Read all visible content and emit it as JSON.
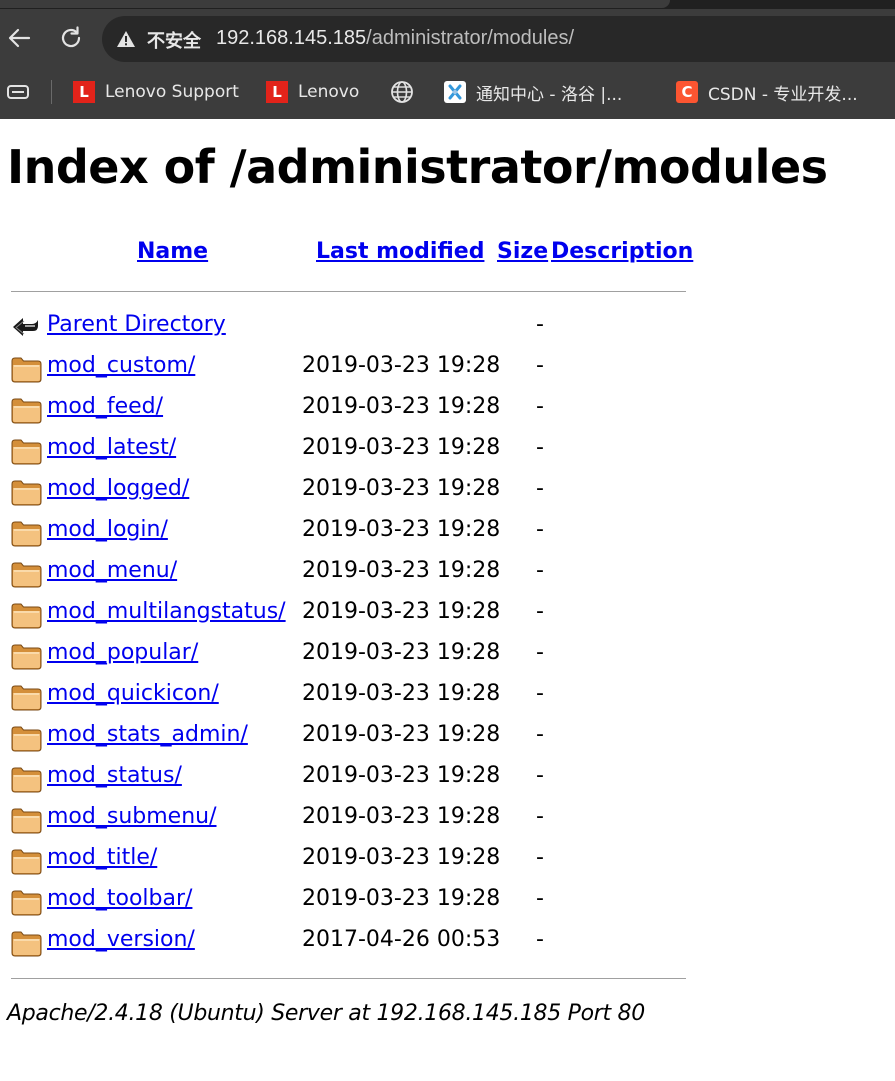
{
  "browser": {
    "security_label": "不安全",
    "url_host": "192.168.145.185",
    "url_path": "/administrator/modules/",
    "bookmarks": [
      {
        "label": "Lenovo Support",
        "icon": "lenovo-l-icon",
        "color": "#e2231a"
      },
      {
        "label": "Lenovo",
        "icon": "lenovo-l-icon",
        "color": "#e2231a"
      },
      {
        "label": "",
        "icon": "globe-icon",
        "color": "#e8e8e8"
      },
      {
        "label": "通知中心 - 洛谷 |...",
        "icon": "luogu-icon",
        "color": "#3498db"
      },
      {
        "label": "CSDN - 专业开发...",
        "icon": "csdn-c-icon",
        "color": "#fc5531"
      }
    ]
  },
  "page": {
    "title": "Index of /administrator/modules",
    "columns": {
      "name": "Name",
      "last_modified": "Last modified",
      "size": "Size",
      "description": "Description"
    },
    "parent": {
      "name": "Parent Directory",
      "size": "-",
      "icon": "back-arrow-icon"
    },
    "entries": [
      {
        "name": "mod_custom/",
        "modified": "2019-03-23 19:28",
        "size": "-"
      },
      {
        "name": "mod_feed/",
        "modified": "2019-03-23 19:28",
        "size": "-"
      },
      {
        "name": "mod_latest/",
        "modified": "2019-03-23 19:28",
        "size": "-"
      },
      {
        "name": "mod_logged/",
        "modified": "2019-03-23 19:28",
        "size": "-"
      },
      {
        "name": "mod_login/",
        "modified": "2019-03-23 19:28",
        "size": "-"
      },
      {
        "name": "mod_menu/",
        "modified": "2019-03-23 19:28",
        "size": "-"
      },
      {
        "name": "mod_multilangstatus/",
        "modified": "2019-03-23 19:28",
        "size": "-"
      },
      {
        "name": "mod_popular/",
        "modified": "2019-03-23 19:28",
        "size": "-"
      },
      {
        "name": "mod_quickicon/",
        "modified": "2019-03-23 19:28",
        "size": "-"
      },
      {
        "name": "mod_stats_admin/",
        "modified": "2019-03-23 19:28",
        "size": "-"
      },
      {
        "name": "mod_status/",
        "modified": "2019-03-23 19:28",
        "size": "-"
      },
      {
        "name": "mod_submenu/",
        "modified": "2019-03-23 19:28",
        "size": "-"
      },
      {
        "name": "mod_title/",
        "modified": "2019-03-23 19:28",
        "size": "-"
      },
      {
        "name": "mod_toolbar/",
        "modified": "2019-03-23 19:28",
        "size": "-"
      },
      {
        "name": "mod_version/",
        "modified": "2017-04-26 00:53",
        "size": "-"
      }
    ],
    "entry_icon": "folder-icon",
    "address": "Apache/2.4.18 (Ubuntu) Server at 192.168.145.185 Port 80"
  }
}
